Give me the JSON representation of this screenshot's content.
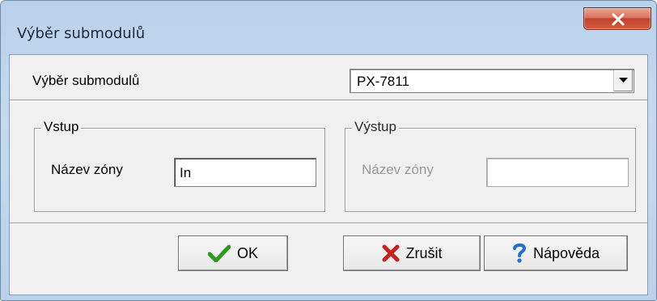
{
  "window": {
    "title": "Výběr submodulů",
    "close_icon": "close-icon"
  },
  "submodule_select": {
    "label": "Výběr submodulů",
    "value": "PX-7811",
    "dropdown_icon": "chevron-down-icon"
  },
  "input_group": {
    "legend": "Vstup",
    "zone_label": "Název zóny",
    "zone_value": "In"
  },
  "output_group": {
    "legend": "Výstup",
    "zone_label": "Název zóny",
    "zone_value": ""
  },
  "buttons": {
    "ok_label": "OK",
    "ok_icon": "check-icon",
    "cancel_label": "Zrušit",
    "cancel_icon": "cross-icon",
    "help_label": "Nápověda",
    "help_icon": "question-icon"
  },
  "colors": {
    "check_green": "#2f9a1e",
    "cross_red": "#c8201a",
    "help_blue": "#1f6fd0",
    "close_red": "#c2412b"
  }
}
